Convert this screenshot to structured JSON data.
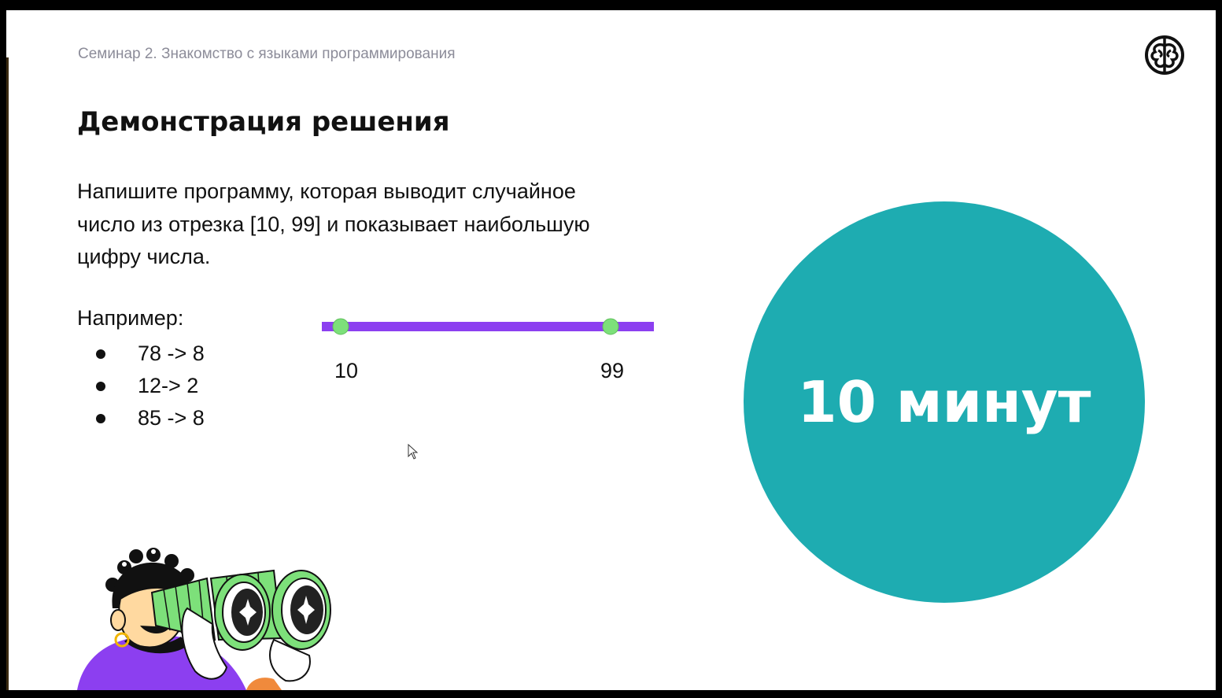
{
  "slide": {
    "breadcrumb": "Семинар 2. Знакомство с языками программирования",
    "title": "Демонстрация решения",
    "task_lines": [
      "Напишите программу, которая выводит случайное",
      "число из отрезка [10, 99] и показывает наибольшую",
      "цифру числа."
    ],
    "example_label": "Например:",
    "examples": [
      "78 -> 8",
      "12-> 2",
      "85 -> 8"
    ],
    "range": {
      "min_label": "10",
      "max_label": "99",
      "bar_color": "#8c3ff0",
      "point_color": "#7de07a"
    },
    "timer": {
      "text": "10 минут",
      "color": "#1eacb1"
    }
  },
  "icons": {
    "logo": "brain-logo-icon",
    "cursor": "mouse-pointer-icon",
    "illustration": "person-with-binoculars-illustration"
  },
  "colors": {
    "background": "#ffffff",
    "frame": "#000000",
    "breadcrumb_text": "#8c8c99",
    "accent_purple": "#8c3ff0",
    "accent_green": "#7de07a",
    "accent_teal": "#1eacb1"
  }
}
